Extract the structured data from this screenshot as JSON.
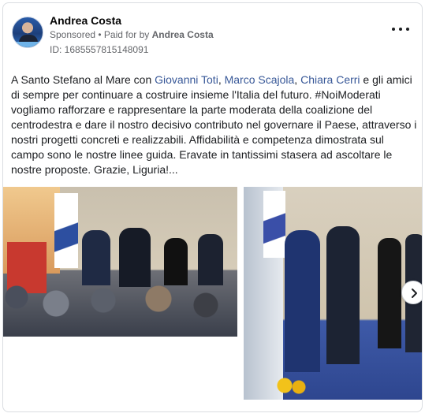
{
  "post": {
    "author": "Andrea Costa",
    "sponsored": "Sponsored",
    "separator": " • ",
    "paid_for_prefix": "Paid for by ",
    "paid_for_name": "Andrea Costa",
    "ad_id": "ID: 1685557815148091",
    "text_part1": "A Santo Stefano al Mare con ",
    "mention1": "Giovanni Toti",
    "comma1": ", ",
    "mention2": "Marco Scajola",
    "comma2": ", ",
    "mention3": "Chiara Cerri",
    "text_part2": " e gli amici di sempre per continuare a costruire insieme l'Italia del futuro. #NoiModerati vogliamo rafforzare e rappresentare la parte moderata della coalizione del centrodestra e dare il nostro decisivo contributo nel governare il Paese, attraverso i nostri progetti concreti e realizzabili. Affidabilità e competenza dimostrata sul campo sono le nostre linee guida. Eravate in tantissimi stasera ad ascoltare le nostre proposte. Grazie, Liguria!..."
  },
  "icons": {
    "more": "more-options-icon",
    "next": "chevron-right-icon"
  },
  "colors": {
    "link": "#385898",
    "muted": "#65676b",
    "border": "#dadde1"
  }
}
